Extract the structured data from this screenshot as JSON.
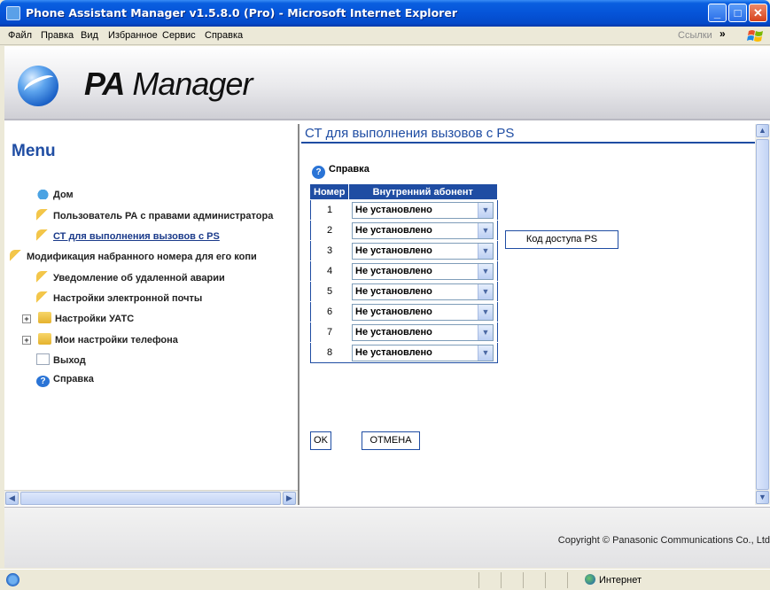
{
  "window": {
    "title": "Phone Assistant Manager v1.5.8.0 (Pro) - Microsoft Internet Explorer"
  },
  "menubar": {
    "items": [
      "Файл",
      "Правка",
      "Вид",
      "Избранное",
      "Сервис",
      "Справка"
    ],
    "links_label": "Ссылки"
  },
  "logo": {
    "bold": "PA",
    "rest": "Manager"
  },
  "sidebar": {
    "title": "Menu",
    "items": [
      {
        "label": "Дом",
        "icon": "house-icon"
      },
      {
        "label": "Пользователь РА с правами администратора",
        "icon": "key-icon"
      },
      {
        "label": "СТ для выполнения вызовов с PS",
        "icon": "key-icon",
        "active": true
      },
      {
        "label": "Модификация набранного номера для его копи",
        "icon": "key-icon"
      },
      {
        "label": "Уведомление об удаленной аварии",
        "icon": "key-icon"
      },
      {
        "label": "Настройки электронной почты",
        "icon": "key-icon"
      },
      {
        "label": "Настройки УАТС",
        "icon": "folder-icon",
        "expandable": true
      },
      {
        "label": "Мои настройки телефона",
        "icon": "folder-icon",
        "expandable": true
      },
      {
        "label": "Выход",
        "icon": "document-icon"
      },
      {
        "label": "Справка",
        "icon": "help-icon"
      }
    ]
  },
  "main": {
    "title": "СТ для выполнения вызовов с PS",
    "help_label": "Справка",
    "table": {
      "headers": [
        "Номер",
        "Внутренний абонент"
      ],
      "rows": [
        {
          "num": "1",
          "value": "Не установлено"
        },
        {
          "num": "2",
          "value": "Не установлено"
        },
        {
          "num": "3",
          "value": "Не установлено"
        },
        {
          "num": "4",
          "value": "Не установлено"
        },
        {
          "num": "5",
          "value": "Не установлено"
        },
        {
          "num": "6",
          "value": "Не установлено"
        },
        {
          "num": "7",
          "value": "Не установлено"
        },
        {
          "num": "8",
          "value": "Не установлено"
        }
      ]
    },
    "access_code_button": "Код доступа PS",
    "ok_button": "OK",
    "cancel_button": "ОТМЕНА"
  },
  "footer": {
    "copyright": "Copyright © Panasonic Communications Co., Ltd"
  },
  "statusbar": {
    "zone": "Интернет"
  },
  "colors": {
    "accent": "#1f4da3",
    "titlebar": "#0554d8"
  }
}
